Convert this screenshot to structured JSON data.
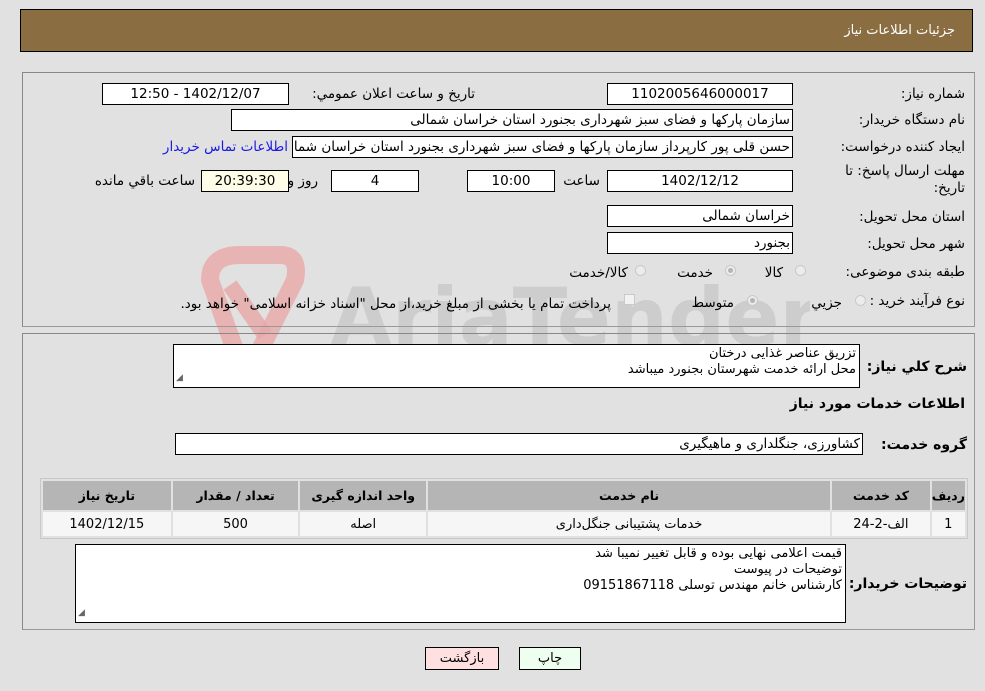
{
  "header": {
    "title": "جزئیات اطلاعات نیاز"
  },
  "details": {
    "need_number_label": "شماره نیاز:",
    "need_number": "1102005646000017",
    "announce_label": "تاریخ و ساعت اعلان عمومي:",
    "announce_value": "1402/12/07 - 12:50",
    "buyer_org_label": "نام دستگاه خريدار:",
    "buyer_org": "سازمان پارکها و فضای سبز شهرداری بجنورد استان خراسان شمالی",
    "creator_label": "ایجاد کننده درخواست:",
    "creator": "حسن  قلی پور  کارپرداز سازمان پارکها و فضای سبز شهرداری بجنورد استان خراسان شمالی",
    "contact_link": "اطلاعات تماس خریدار",
    "deadline_label_1": "مهلت ارسال پاسخ: تا",
    "deadline_label_2": "تاریخ:",
    "deadline_date": "1402/12/12",
    "time_label": "ساعت",
    "deadline_time": "10:00",
    "days_value": "4",
    "days_label": "روز و",
    "remaining_time": "20:39:30",
    "remaining_label": "ساعت باقي مانده",
    "province_label": "استان محل تحویل:",
    "province": "خراسان شمالی",
    "city_label": "شهر محل تحویل:",
    "city": "بجنورد",
    "category_label": "طبقه بندی موضوعی:",
    "category_options": [
      "کالا",
      "خدمت",
      "کالا/خدمت"
    ],
    "category_selected": "خدمت",
    "process_label": "نوع فرآیند خرید :",
    "process_options": [
      "جزيي",
      "متوسط"
    ],
    "process_selected": "متوسط",
    "payment_note": "پرداخت تمام یا بخشی از مبلغ خرید،از محل \"اسناد خزانه اسلامی\" خواهد بود."
  },
  "description": {
    "label": "شرح کلي نياز:",
    "lines": [
      "تزریق عناصر غذایی درختان",
      "محل ارائه خدمت شهرستان بجنورد میباشد"
    ]
  },
  "services": {
    "section_title": "اطلاعات خدمات مورد نیاز",
    "group_label": "گروه خدمت:",
    "group_value": "کشاورزی، جنگلداری و ماهیگیری",
    "columns": [
      "ردیف",
      "کد خدمت",
      "نام خدمت",
      "واحد اندازه گیری",
      "تعداد / مقدار",
      "تاریخ نیاز"
    ],
    "rows": [
      [
        "1",
        "الف-2-24",
        "خدمات پشتیبانی جنگل‌داری",
        "اصله",
        "500",
        "1402/12/15"
      ]
    ]
  },
  "buyer_notes": {
    "label": "توضیحات خریدار:",
    "lines": [
      "قیمت اعلامی نهایی بوده و قابل تغییر نمیبا شد",
      "توضیحات در پیوست",
      "کارشناس خانم مهندس توسلی 09151867118"
    ]
  },
  "buttons": {
    "print": "چاپ",
    "back": "بازگشت"
  },
  "colors": {
    "header": "#8b6d42",
    "print_bg": "#efffef",
    "back_bg": "#ffe0e0",
    "link": "#1a1ae0"
  }
}
